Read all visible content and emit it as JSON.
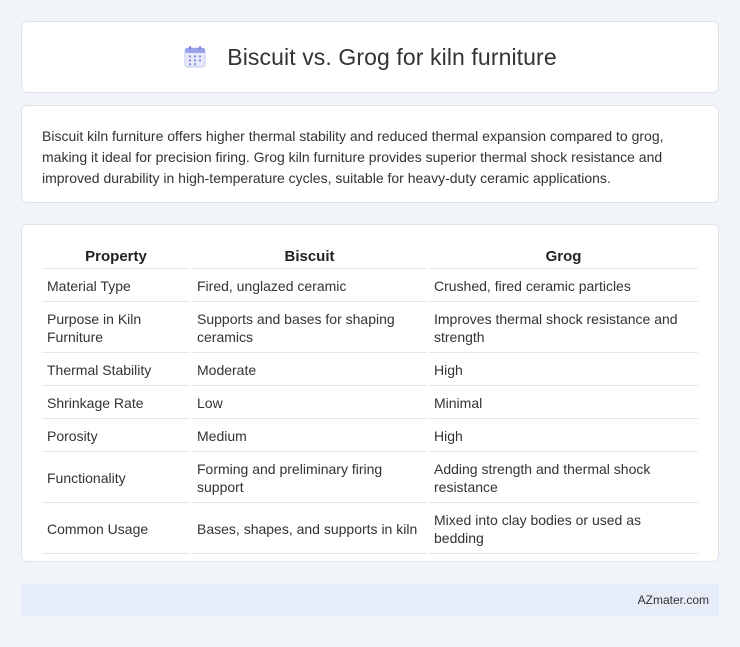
{
  "header": {
    "title": "Biscuit vs. Grog for kiln furniture",
    "icon": "calendar-icon"
  },
  "description": "Biscuit kiln furniture offers higher thermal stability and reduced thermal expansion compared to grog, making it ideal for precision firing. Grog kiln furniture provides superior thermal shock resistance and improved durability in high-temperature cycles, suitable for heavy-duty ceramic applications.",
  "table": {
    "headers": [
      "Property",
      "Biscuit",
      "Grog"
    ],
    "rows": [
      [
        "Material Type",
        "Fired, unglazed ceramic",
        "Crushed, fired ceramic particles"
      ],
      [
        "Purpose in Kiln Furniture",
        "Supports and bases for shaping ceramics",
        "Improves thermal shock resistance and strength"
      ],
      [
        "Thermal Stability",
        "Moderate",
        "High"
      ],
      [
        "Shrinkage Rate",
        "Low",
        "Minimal"
      ],
      [
        "Porosity",
        "Medium",
        "High"
      ],
      [
        "Functionality",
        "Forming and preliminary firing support",
        "Adding strength and thermal shock resistance"
      ],
      [
        "Common Usage",
        "Bases, shapes, and supports in kiln",
        "Mixed into clay bodies or used as bedding"
      ]
    ]
  },
  "footer": {
    "text": "AZmater.com"
  },
  "colors": {
    "background": "#f1f4f9",
    "card": "#ffffff",
    "footer_bg": "#e6edf8",
    "icon_accent": "#7b86e0"
  }
}
